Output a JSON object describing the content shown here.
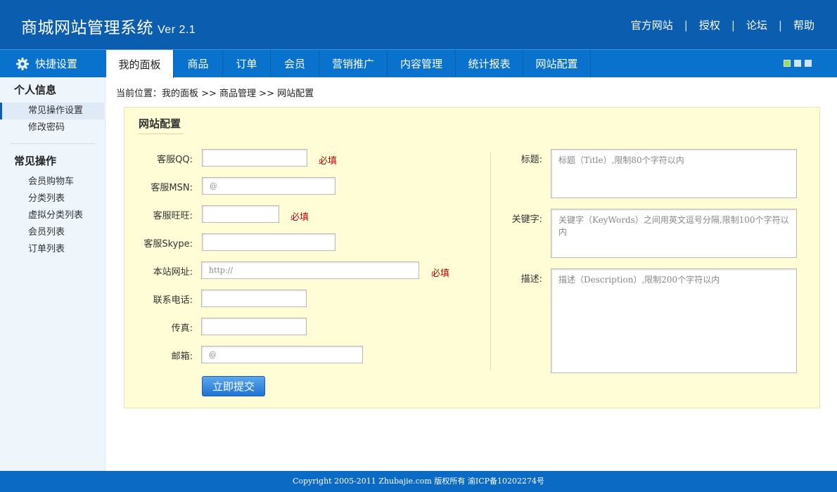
{
  "header": {
    "title": "商城网站管理系统",
    "version": "Ver 2.1",
    "links": [
      "官方网站",
      "授权",
      "论坛",
      "帮助"
    ],
    "separator": "|"
  },
  "nav": {
    "quick_label": "快捷设置",
    "tabs": [
      "我的面板",
      "商品",
      "订单",
      "会员",
      "营销推广",
      "内容管理",
      "统计报表",
      "网站配置"
    ],
    "active_tab": "我的面板"
  },
  "sidebar": {
    "section1_title": "个人信息",
    "section1_items": [
      "常见操作设置",
      "修改密码"
    ],
    "section2_title": "常见操作",
    "section2_items": [
      "会员购物车",
      "分类列表",
      "虚拟分类列表",
      "会员列表",
      "订单列表"
    ]
  },
  "breadcrumb": "当前位置：我的面板 >> 商品管理 >> 网站配置",
  "form": {
    "title": "网站配置",
    "required_text": "必填",
    "fields": {
      "qq_label": "客服QQ:",
      "msn_label": "客服MSN:",
      "msn_value": "@",
      "wangwang_label": "客服旺旺:",
      "skype_label": "客服Skype:",
      "url_label": "本站网址:",
      "url_value": "http://",
      "phone_label": "联系电话:",
      "fax_label": "传真:",
      "email_label": "邮箱:",
      "email_value": "@"
    },
    "seo": {
      "title_label": "标题:",
      "title_placeholder": "标题（Title）,限制80个字符以内",
      "keywords_label": "关键字:",
      "keywords_placeholder": "关键字（KeyWords）之间用英文逗号分隔,限制100个字符以内",
      "description_label": "描述:",
      "description_placeholder": "描述（Description）,限制200个字符以内"
    },
    "submit_label": "立即提交"
  },
  "footer": "Copyright 2005-2011 Zhubajie.com 版权所有 渝ICP备10202274号",
  "colors": {
    "header_bg": "#0b5db0",
    "nav_bg": "#0972cc",
    "panel_bg": "#fefdd6",
    "required": "#c40000",
    "button": "#1f74d2"
  },
  "icons": [
    "gear-icon",
    "view-grid-icon",
    "view-detail-icon",
    "view-list-icon"
  ]
}
